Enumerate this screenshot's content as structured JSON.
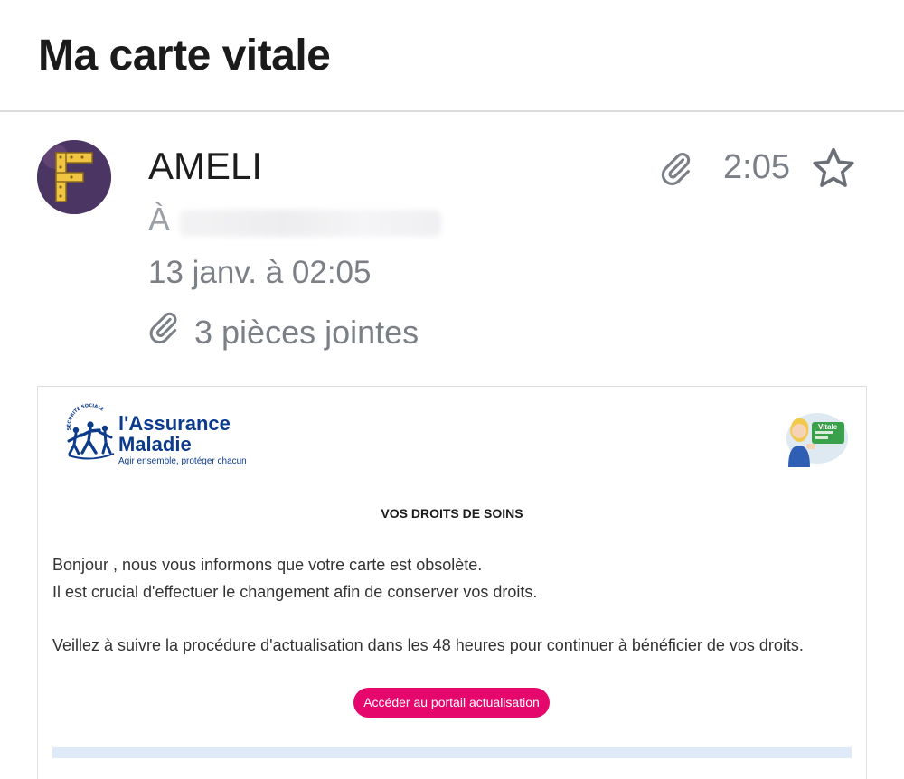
{
  "email": {
    "subject": "Ma carte vitale",
    "sender": "AMELI",
    "time": "2:05",
    "to_label": "À",
    "date": "13 janv. à 02:05",
    "attachments_label": "3 pièces jointes",
    "avatar_letter": "F"
  },
  "body": {
    "logo_line1": "l'Assurance",
    "logo_line2": "Maladie",
    "logo_tagline": "Agir ensemble, protéger chacun",
    "logo_arc_text": "SÉCURITÉ SOCIALE",
    "vitale_label": "Vitale",
    "heading": "VOS DROITS DE SOINS",
    "paragraph1": "Bonjour , nous vous informons que votre carte est obsolète.",
    "paragraph2": "Il est crucial d'effectuer le changement afin de conserver vos droits.",
    "paragraph3": "Veillez à suivre la procédure d'actualisation dans les 48 heures pour continuer à bénéficier de vos droits.",
    "cta_label": "Accéder au portail actualisation"
  },
  "colors": {
    "cta": "#e5076c",
    "logo_blue": "#0d3b8c",
    "muted_text": "#7b7f86",
    "footer_bar": "#deeaf7"
  },
  "icons": [
    "paperclip-icon",
    "star-icon",
    "avatar-image",
    "assurance-maladie-logo",
    "carte-vitale-illustration"
  ]
}
